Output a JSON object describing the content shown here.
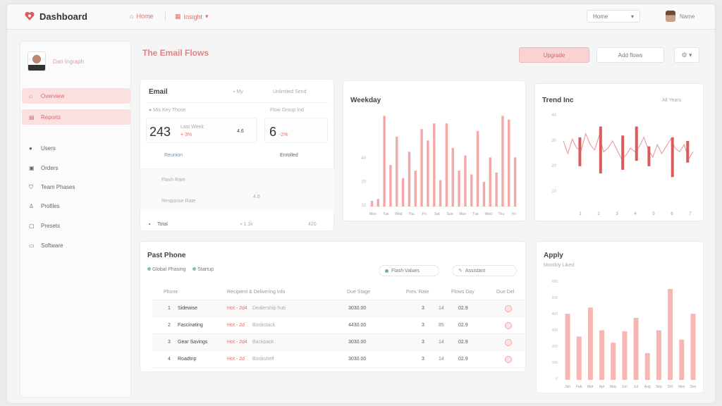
{
  "app": {
    "title": "Dashboard",
    "brand_color": "#e05a5a"
  },
  "nav": {
    "item1": "Home",
    "item2": "Insight"
  },
  "header": {
    "home_select": "Home",
    "user_name": "Name"
  },
  "sidebar": {
    "profile_name": "Dan Ingraph",
    "items": [
      {
        "label": "Overview",
        "icon": "home-icon",
        "active": true
      },
      {
        "label": "Reports",
        "icon": "calendar-icon",
        "active": true
      },
      {
        "label": "Users",
        "icon": "users-icon",
        "active": false
      },
      {
        "label": "Orders",
        "icon": "box-icon",
        "active": false
      },
      {
        "label": "Team Phases",
        "icon": "shield-icon",
        "active": false
      },
      {
        "label": "Profiles",
        "icon": "person-icon",
        "active": false
      },
      {
        "label": "Presets",
        "icon": "camera-icon",
        "active": false
      },
      {
        "label": "Software",
        "icon": "briefcase-icon",
        "active": false
      }
    ]
  },
  "page": {
    "title": "The Email Flows",
    "primary_button": "Upgrade",
    "secondary_button": "Add flows",
    "settings_button": "⚙ ▾"
  },
  "overview": {
    "title": "Email",
    "tag": "▪ My",
    "link": "Unlimited Send",
    "left_label": "● Mis Key Those",
    "right_label": "Flow Group Ind",
    "big1": "243",
    "big1_sub": "Last Week",
    "big1_delta": "+ 3%",
    "small1": "4.6",
    "big2": "6",
    "big2_delta": "-2%",
    "footer1": "Reunion",
    "footer2": "Enrolled",
    "row1": "Flash Rate",
    "row2": "Response Rate",
    "row2_val": "4.6",
    "bottom_label": "Total",
    "bottom_mid": "▪ 1.1k",
    "bottom_right": "420"
  },
  "weekly": {
    "title": "Weekday",
    "y_ticks": [
      "",
      "40",
      "20",
      "10"
    ],
    "x_ticks": [
      "Mon",
      "Tue",
      "Wed",
      "Thu",
      "Fri",
      "Sat",
      "Sun",
      "Mon",
      "Tue",
      "Wed",
      "Thu",
      "Fri"
    ]
  },
  "trend": {
    "title": "Trend Inc",
    "link": "All Years",
    "y_ticks": [
      "40",
      "30",
      "20",
      "10"
    ],
    "x_ticks": [
      "1",
      "2",
      "3",
      "4",
      "5",
      "6",
      "7"
    ]
  },
  "recent": {
    "title": "Past Phone",
    "filter1": "Global Phasing",
    "filter2": "Startup",
    "pill1": "Flash Values",
    "pill2": "Assistant",
    "headers": [
      "Phone",
      "Recipient & Delivering Info",
      "Due Stage",
      "Prev. Rate",
      "Flows Day",
      "Due Del"
    ],
    "rows": [
      {
        "n": "1",
        "name": "Sidewise",
        "tag": "Hot - 2d4",
        "info": "Dealership hub",
        "stage": "3030.00",
        "prev": "3",
        "flows": "14",
        "day": "02.9"
      },
      {
        "n": "2",
        "name": "Fascinating",
        "tag": "Hot - 2d",
        "info": "Bookstack",
        "stage": "4430.00",
        "prev": "3",
        "flows": "85",
        "day": "02.9"
      },
      {
        "n": "3",
        "name": "Gear Savings",
        "tag": "Hot - 2d4",
        "info": "Backpack",
        "stage": "3030.00",
        "prev": "3",
        "flows": "14",
        "day": "02.9"
      },
      {
        "n": "4",
        "name": "Roadtrip",
        "tag": "Hot - 2d",
        "info": "Bookshelf",
        "stage": "3030.00",
        "prev": "3",
        "flows": "14",
        "day": "02.9"
      }
    ]
  },
  "apply": {
    "title": "Apply",
    "subtitle": "Monthly Liked",
    "y_ticks": [
      "600",
      "500",
      "400",
      "300",
      "200",
      "100",
      "0"
    ],
    "x_ticks": [
      "Jan",
      "Feb",
      "Mar",
      "Apr",
      "May",
      "Jun",
      "Jul",
      "Aug",
      "Sep",
      "Oct",
      "Nov",
      "Dec"
    ]
  },
  "chart_data": [
    {
      "type": "bar",
      "title": "Weekday",
      "ylim": [
        0,
        50
      ],
      "values": [
        3,
        4,
        48,
        22,
        37,
        15,
        29,
        19,
        41,
        35,
        44,
        14,
        44,
        31,
        19,
        27,
        17,
        40,
        13,
        26,
        18,
        48,
        46,
        26
      ]
    },
    {
      "type": "line",
      "title": "Trend Inc",
      "ylim": [
        0,
        50
      ],
      "series": [
        {
          "values": [
            34,
            27,
            35,
            30,
            29,
            38,
            32,
            29,
            37,
            28,
            30,
            34,
            29,
            24,
            26,
            30,
            28,
            31,
            36,
            29,
            25,
            32,
            27,
            31,
            35,
            30,
            28,
            32,
            24,
            28
          ]
        }
      ],
      "bars": [
        {
          "x": 0.15,
          "from": 20,
          "to": 36
        },
        {
          "x": 0.3,
          "from": 16,
          "to": 42
        },
        {
          "x": 0.46,
          "from": 18,
          "to": 37
        },
        {
          "x": 0.56,
          "from": 23,
          "to": 42
        },
        {
          "x": 0.65,
          "from": 20,
          "to": 31
        },
        {
          "x": 0.82,
          "from": 14,
          "to": 36
        },
        {
          "x": 0.93,
          "from": 22,
          "to": 34
        }
      ]
    },
    {
      "type": "bar",
      "title": "Apply",
      "ylim": [
        0,
        600
      ],
      "values": [
        320,
        210,
        350,
        240,
        180,
        235,
        300,
        130,
        240,
        440,
        195,
        320
      ]
    }
  ]
}
